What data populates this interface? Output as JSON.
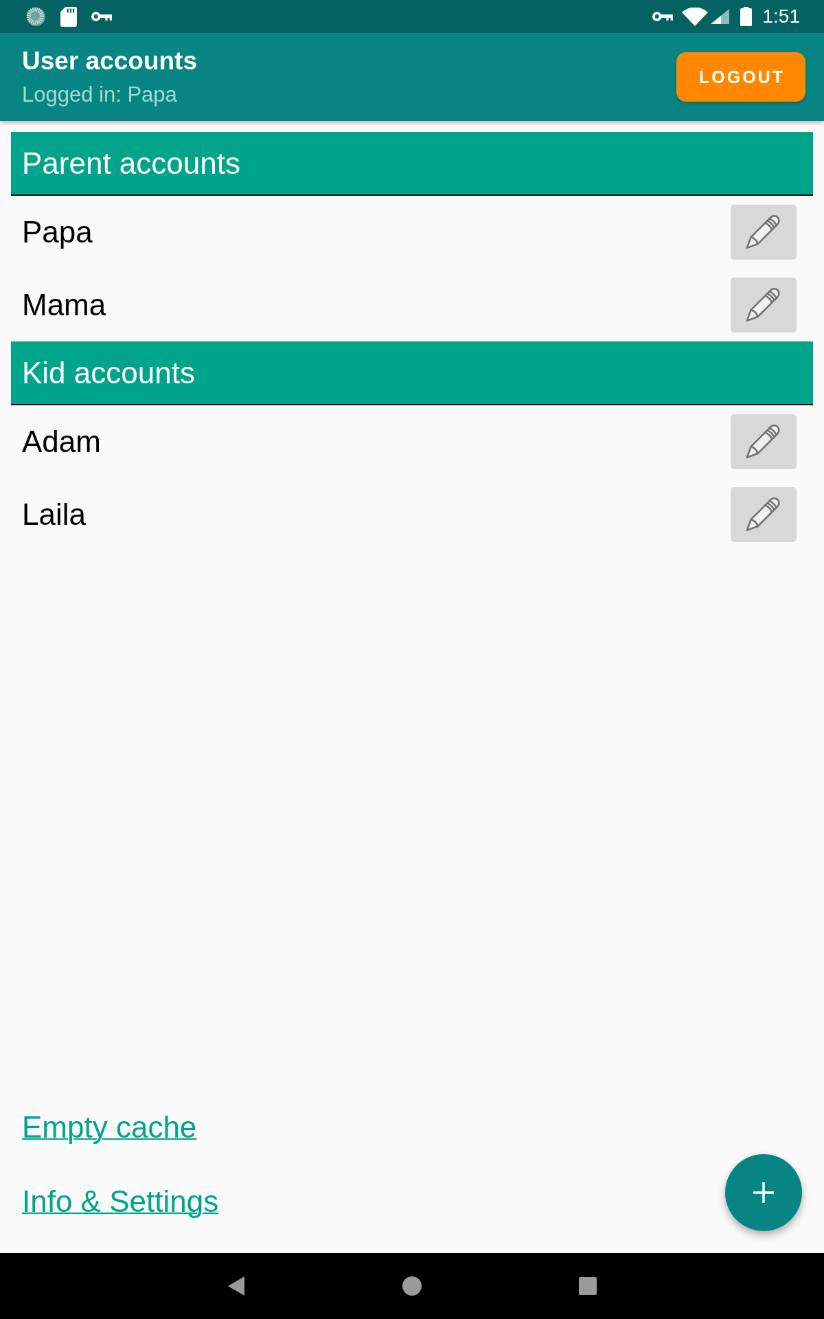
{
  "status_bar": {
    "time": "1:51"
  },
  "app_bar": {
    "title": "User accounts",
    "subtitle": "Logged in: Papa",
    "logout_button": "LOGOUT"
  },
  "sections": [
    {
      "title": "Parent accounts",
      "accounts": [
        "Papa",
        "Mama"
      ]
    },
    {
      "title": "Kid accounts",
      "accounts": [
        "Adam",
        "Laila"
      ]
    }
  ],
  "links": [
    "Empty cache",
    "Info & Settings"
  ]
}
